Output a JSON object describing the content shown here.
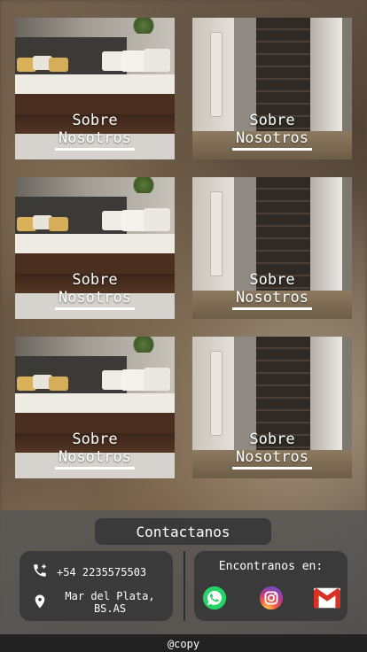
{
  "cards": [
    {
      "line1": "Sobre",
      "line2": "Nosotros",
      "photo": "bedroom"
    },
    {
      "line1": "Sobre",
      "line2": "Nosotros",
      "photo": "wardrobe"
    },
    {
      "line1": "Sobre",
      "line2": "Nosotros",
      "photo": "bedroom"
    },
    {
      "line1": "Sobre",
      "line2": "Nosotros",
      "photo": "wardrobe"
    },
    {
      "line1": "Sobre",
      "line2": "Nosotros",
      "photo": "bedroom"
    },
    {
      "line1": "Sobre",
      "line2": "Nosotros",
      "photo": "wardrobe"
    }
  ],
  "footer": {
    "contact_button": "Contactanos",
    "phone": "+54 2235575503",
    "location": "Mar del Plata, BS.AS",
    "social_title": "Encontranos en:",
    "social_icons": [
      "whatsapp-icon",
      "instagram-icon",
      "gmail-icon"
    ],
    "copyright": "@copy"
  },
  "colors": {
    "panel": "#3a3a3a",
    "footer_bg": "#555555",
    "bottom_bar": "#222222",
    "whatsapp": "#25d366",
    "gmail_red": "#d93025"
  }
}
